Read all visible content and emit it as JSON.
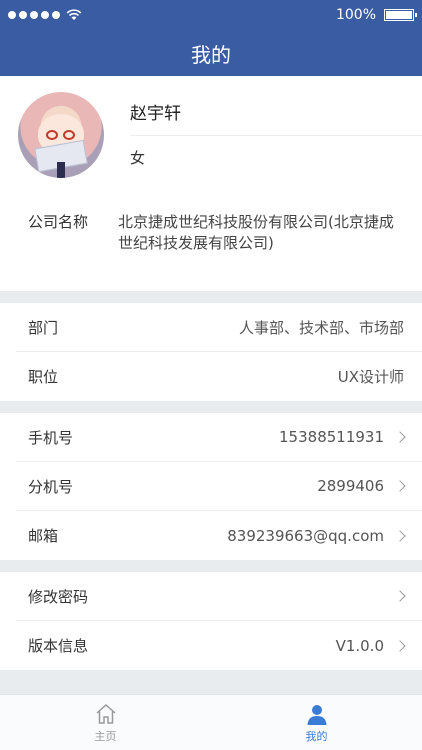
{
  "status_bar": {
    "battery": "100%",
    "battery_level": 1.0
  },
  "nav": {
    "title": "我的"
  },
  "profile": {
    "name": "赵宇轩",
    "gender": "女"
  },
  "company": {
    "label": "公司名称",
    "value": "北京捷成世纪科技股份有限公司(北京捷成世纪科技发展有限公司)"
  },
  "org": {
    "department_label": "部门",
    "department_value": "人事部、技术部、市场部",
    "position_label": "职位",
    "position_value": "UX设计师"
  },
  "contact": {
    "phone_label": "手机号",
    "phone_value": "15388511931",
    "ext_label": "分机号",
    "ext_value": "2899406",
    "email_label": "邮箱",
    "email_value": "839239663@qq.com"
  },
  "settings": {
    "password_label": "修改密码",
    "version_label": "版本信息",
    "version_value": "V1.0.0"
  },
  "tabs": {
    "home": "主页",
    "mine": "我的"
  },
  "colors": {
    "header": "#3a5ca3",
    "active_tab": "#3a7bd5"
  }
}
